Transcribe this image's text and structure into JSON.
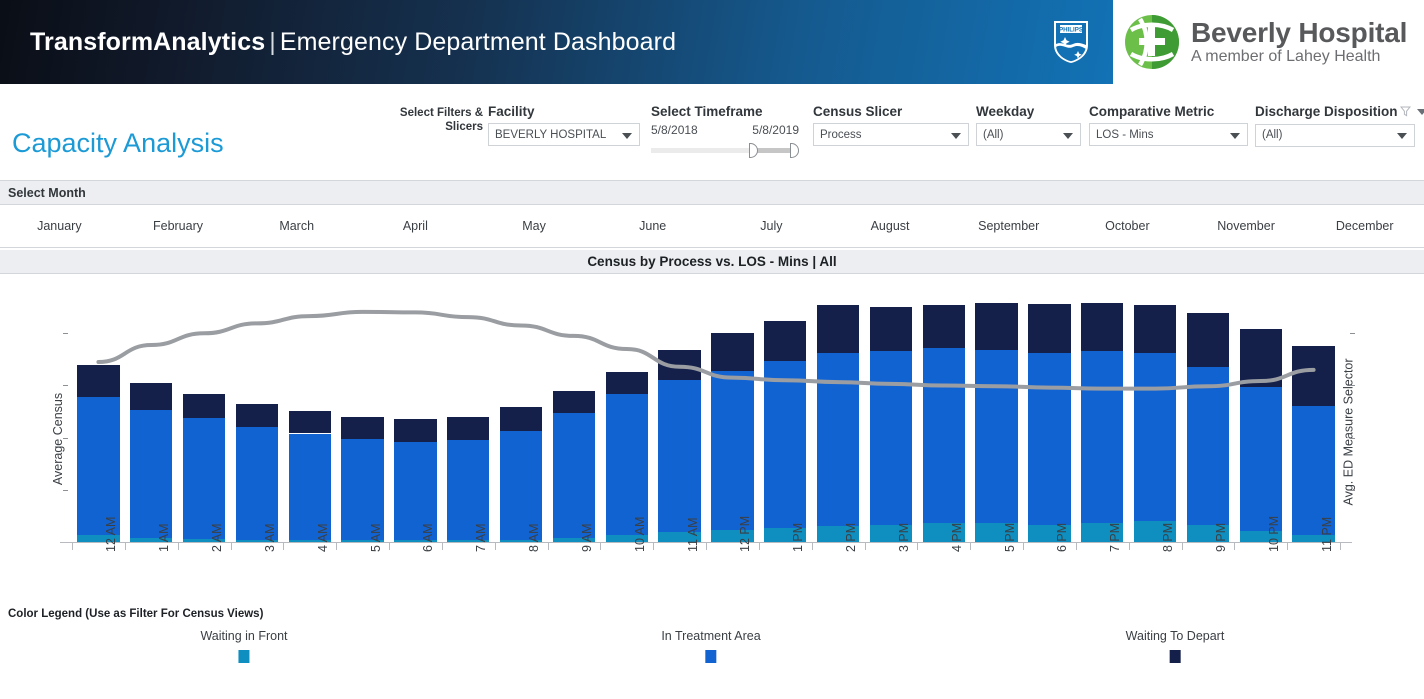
{
  "header": {
    "brand": "TransformAnalytics",
    "separator": "|",
    "subtitle": "Emergency Department Dashboard",
    "philips_wordmark": "PHILIPS",
    "hospital_name": "Beverly Hospital",
    "hospital_tagline": "A member of Lahey Health"
  },
  "page": {
    "title": "Capacity Analysis",
    "filters_note": "Select Filters & Slicers"
  },
  "filters": {
    "facility": {
      "label": "Facility",
      "value": "BEVERLY HOSPITAL"
    },
    "timeframe": {
      "label": "Select Timeframe",
      "start": "5/8/2018",
      "end": "5/8/2019"
    },
    "census_slicer": {
      "label": "Census Slicer",
      "value": "Process"
    },
    "weekday": {
      "label": "Weekday",
      "value": "(All)"
    },
    "comparative_metric": {
      "label": "Comparative Metric",
      "value": "LOS - Mins"
    },
    "discharge_disposition": {
      "label": "Discharge Disposition",
      "value": "(All)"
    }
  },
  "month_selector": {
    "title": "Select Month",
    "months": [
      "January",
      "February",
      "March",
      "April",
      "May",
      "June",
      "July",
      "August",
      "September",
      "October",
      "November",
      "December"
    ]
  },
  "legend": {
    "title": "Color Legend (Use as Filter For Census Views)",
    "items": [
      {
        "label": "Waiting in Front",
        "color": "#0e8fc0"
      },
      {
        "label": "In Treatment Area",
        "color": "#1263d2"
      },
      {
        "label": "Waiting To Depart",
        "color": "#14204a"
      }
    ]
  },
  "chart_data": {
    "type": "bar",
    "title": "Census by Process vs. LOS - Mins | All",
    "xlabel": "",
    "ylabel": "Average Census",
    "y2label": "Avg. ED Measure Selector",
    "ylim": [
      0,
      46
    ],
    "y2lim": [
      0,
      920
    ],
    "yticks": [
      0,
      10,
      20,
      30,
      40
    ],
    "y2ticks": [
      0,
      200,
      400,
      600,
      800
    ],
    "grid": false,
    "legend_position": "bottom",
    "stacked": true,
    "categories": [
      "12 AM",
      "1 AM",
      "2 AM",
      "3 AM",
      "4 AM",
      "5 AM",
      "6 AM",
      "7 AM",
      "8 AM",
      "9 AM",
      "10 AM",
      "11 AM",
      "12 PM",
      "1 PM",
      "2 PM",
      "3 PM",
      "4 PM",
      "5 PM",
      "6 PM",
      "7 PM",
      "8 PM",
      "9 PM",
      "10 PM",
      "11 PM"
    ],
    "series": [
      {
        "name": "Waiting in Front",
        "color": "#0e8fc0",
        "values": [
          1.3,
          0.7,
          0.5,
          0.4,
          0.4,
          0.3,
          0.3,
          0.3,
          0.4,
          0.8,
          1.3,
          1.9,
          2.3,
          2.7,
          3.1,
          3.3,
          3.6,
          3.6,
          3.3,
          3.7,
          4.1,
          3.3,
          2.2,
          1.3
        ]
      },
      {
        "name": "In Treatment Area",
        "color": "#1263d2",
        "values": [
          26.4,
          24.6,
          23.2,
          21.6,
          20.4,
          19.5,
          18.8,
          19.3,
          20.8,
          24.0,
          27.1,
          29.2,
          30.5,
          32.0,
          33.2,
          33.3,
          33.5,
          33.2,
          32.9,
          32.9,
          32.1,
          30.3,
          27.6,
          24.8
        ]
      },
      {
        "name": "Waiting To Depart",
        "color": "#14204a",
        "values": [
          6.3,
          5.2,
          4.7,
          4.4,
          4.3,
          4.2,
          4.4,
          4.4,
          4.7,
          4.1,
          4.1,
          5.8,
          7.2,
          7.6,
          9.1,
          8.5,
          8.3,
          9.0,
          9.5,
          9.3,
          9.2,
          10.3,
          11.0,
          11.4
        ]
      }
    ],
    "overlay_line": {
      "name": "Avg. ED Measure Selector",
      "color": "#9a9da1",
      "axis": "right",
      "values": [
        690,
        755,
        800,
        838,
        866,
        882,
        880,
        862,
        830,
        790,
        740,
        672,
        630,
        620,
        613,
        606,
        600,
        597,
        592,
        588,
        588,
        597,
        617,
        660
      ]
    }
  }
}
